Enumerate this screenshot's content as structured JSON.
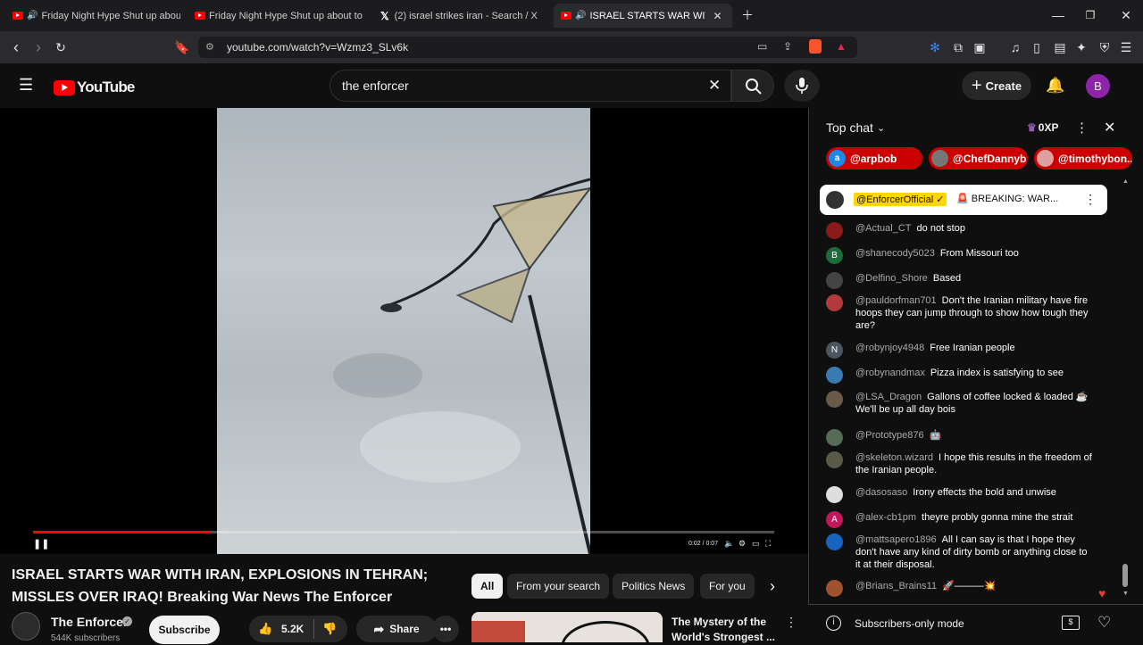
{
  "browser": {
    "tabs": [
      {
        "title": "Friday Night Hype Shut up about"
      },
      {
        "title": "Friday Night Hype Shut up about toe"
      },
      {
        "title": "(2) israel strikes iran - Search / X"
      },
      {
        "title": "ISRAEL STARTS WAR WITH IRA"
      }
    ],
    "url": "youtube.com/watch?v=Wzmz3_SLv6k"
  },
  "youtube": {
    "logo": "YouTube",
    "search_value": "the enforcer",
    "create_label": "Create",
    "avatar_letter": "B"
  },
  "player": {
    "time": "0:02 / 0:07",
    "progress_fraction": 0.24
  },
  "video": {
    "title": "ISRAEL STARTS WAR WITH IRAN, EXPLOSIONS IN TEHRAN; MISSLES OVER IRAQ! Breaking War News The Enforcer",
    "channel": "The Enforcer",
    "subscribers": "544K subscribers",
    "subscribe_label": "Subscribe",
    "likes": "5.2K",
    "share_label": "Share"
  },
  "chips": [
    "All",
    "From your search",
    "Politics News",
    "For you"
  ],
  "recommendation": {
    "title_line1": "The Mystery of the",
    "title_line2": "World's Strongest ..."
  },
  "chat": {
    "mode": "Top chat",
    "xp": "0XP",
    "mentions": [
      "@arpbob",
      "@ChefDannyb",
      "@timothybon..."
    ],
    "pinned_author": "@EnforcerOfficial ✓",
    "pinned_text": "🚨 BREAKING: WAR...",
    "messages": [
      {
        "author": "@Actual_CT",
        "text": "do not stop",
        "color": "#8b1a1a",
        "letter": ""
      },
      {
        "author": "@shanecody5023",
        "text": "From Missouri too",
        "color": "#1e6b3a",
        "letter": "B"
      },
      {
        "author": "@Delfino_Shore",
        "text": "Based",
        "color": "#444444",
        "letter": ""
      },
      {
        "author": "@pauldorfman701",
        "text": "Don't the Iranian military have fire hoops they can jump through to show how tough they are?",
        "color": "#b33a3a",
        "letter": ""
      },
      {
        "author": "@robynjoy4948",
        "text": "Free Iranian people",
        "color": "#4a5560",
        "letter": "N"
      },
      {
        "author": "@robynandmax",
        "text": "Pizza index is satisfying to see",
        "color": "#3a7ab0",
        "letter": ""
      },
      {
        "author": "@LSA_Dragon",
        "text": "Gallons of coffee locked & loaded ☕ We'll be up all day bois",
        "color": "#6b5a4a",
        "letter": ""
      },
      {
        "author": "@Prototype876",
        "text": "🤖",
        "color": "#556b55",
        "letter": ""
      },
      {
        "author": "@skeleton.wizard",
        "text": "I hope this results in the freedom of the Iranian people.",
        "color": "#5a5a4a",
        "letter": ""
      },
      {
        "author": "@dasosaso",
        "text": "Irony effects the bold and unwise",
        "color": "#dddddd",
        "letter": ""
      },
      {
        "author": "@alex-cb1pm",
        "text": "theyre probly gonna mine the strait",
        "color": "#c2185b",
        "letter": "A"
      },
      {
        "author": "@mattsapero1896",
        "text": "All I can say is that I hope they don't have any kind of dirty bomb or anything close to it at their disposal.",
        "color": "#1565c0",
        "letter": ""
      },
      {
        "author": "@Brians_Brains11",
        "text": "🚀———💥",
        "color": "#a0522d",
        "letter": ""
      }
    ],
    "footer_text": "Subscribers-only mode"
  }
}
